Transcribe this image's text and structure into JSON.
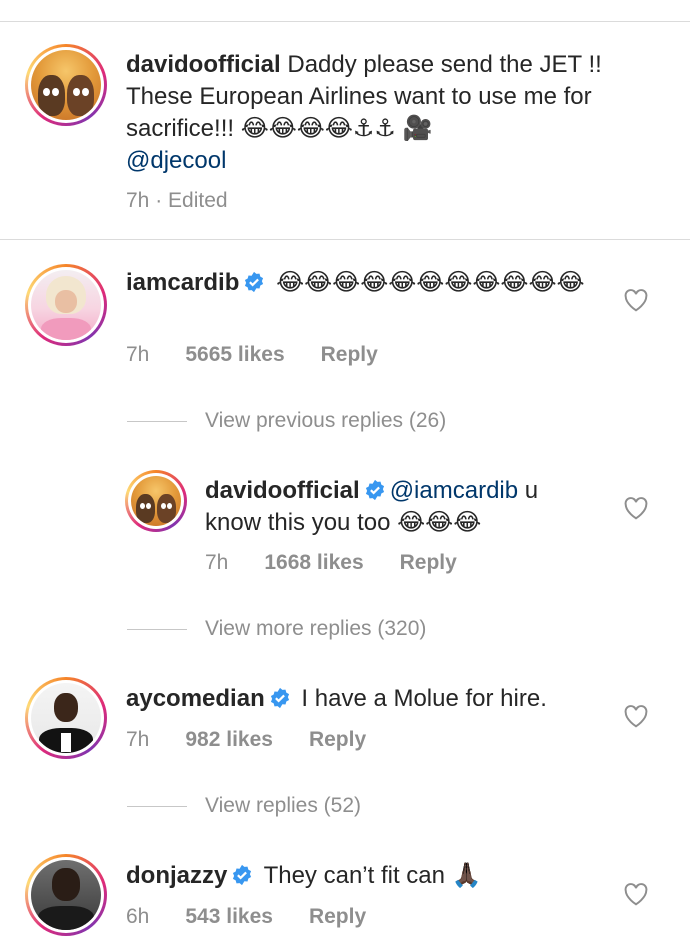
{
  "caption": {
    "username": "davidoofficial",
    "text": "Daddy please send the JET !! These European Airlines want to use me for sacrifice!!! 😂😂😂😂⚓⚓ 🎥",
    "mention": "@djecool",
    "meta": "7h · Edited"
  },
  "comments": [
    {
      "username": "iamcardib",
      "verified": true,
      "text": "😂😂😂😂😂😂😂😂😂😂😂",
      "time": "7h",
      "likes": "5665 likes",
      "reply_label": "Reply"
    },
    {
      "username": "aycomedian",
      "verified": true,
      "text": "I have a Molue for hire.",
      "time": "7h",
      "likes": "982 likes",
      "reply_label": "Reply"
    },
    {
      "username": "donjazzy",
      "verified": true,
      "text": "They can’t fit can 🙏🏿",
      "time": "6h",
      "likes": "543 likes",
      "reply_label": "Reply"
    }
  ],
  "replies": [
    {
      "username": "davidoofficial",
      "verified": true,
      "mention": "@iamcardib",
      "text": "u know this you too 😂😂😂",
      "time": "7h",
      "likes": "1668 likes",
      "reply_label": "Reply"
    }
  ],
  "view_replies": {
    "cardib_previous": "View previous replies (26)",
    "cardib_more": "View more replies (320)",
    "ay": "View replies (52)"
  },
  "colors": {
    "text": "#262626",
    "muted": "#8e8e8e",
    "mention": "#00376b",
    "verified": "#3897f0",
    "divider": "#dbdbdb"
  },
  "icons": {
    "like": "heart-outline-icon",
    "verified": "verified-badge-icon"
  }
}
